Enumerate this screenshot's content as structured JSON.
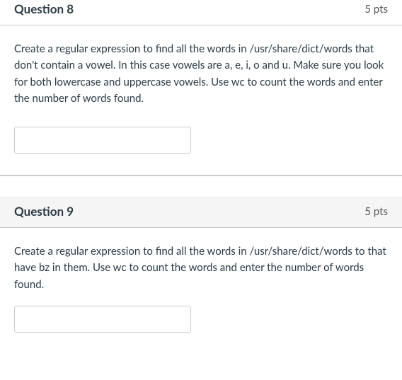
{
  "questions": [
    {
      "title": "Question 8",
      "points": "5 pts",
      "prompt": "Create a regular expression to find all the words in /usr/share/dict/words that don't contain a vowel. In this case vowels are a, e, i, o and u. Make sure you look for both lowercase and uppercase vowels. Use wc to count the words and enter the number of words found.",
      "value": ""
    },
    {
      "title": "Question 9",
      "points": "5 pts",
      "prompt": "Create a regular expression to find all the words in /usr/share/dict/words to  that have bz in them.  Use wc to count the words and enter the number of words found.",
      "value": ""
    }
  ]
}
